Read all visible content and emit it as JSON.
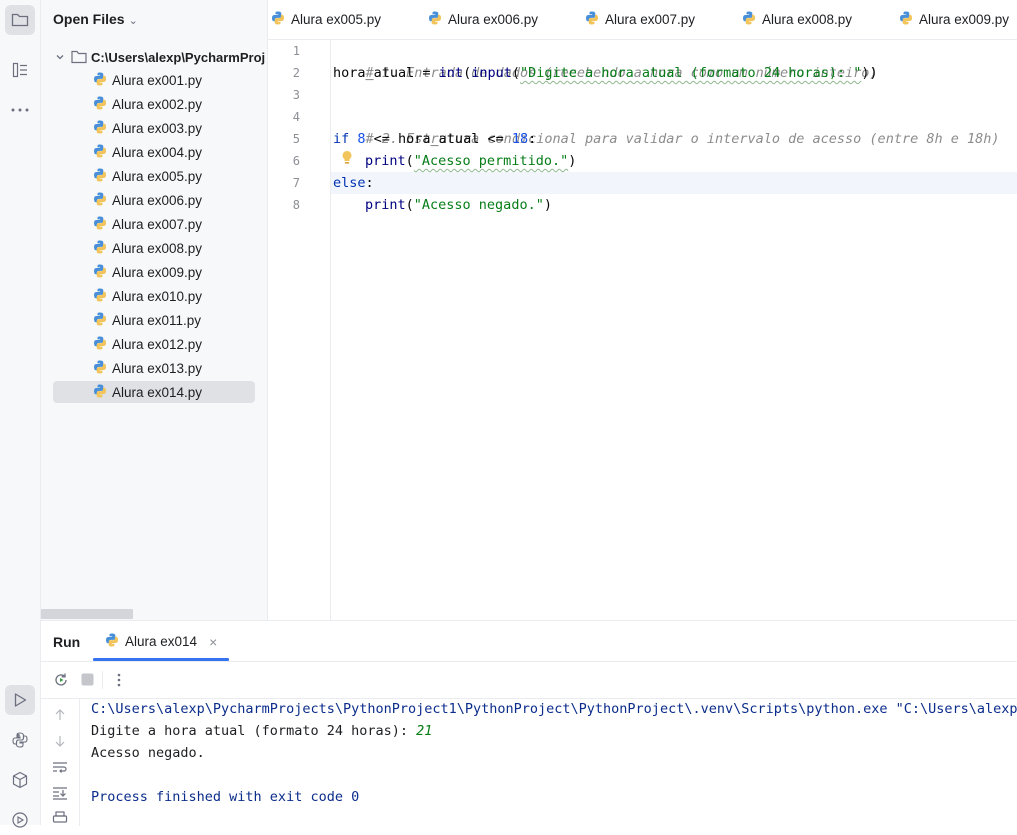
{
  "project_panel": {
    "title": "Open Files",
    "root_label": "C:\\Users\\alexp\\PycharmProj",
    "files": [
      "Alura ex001.py",
      "Alura ex002.py",
      "Alura ex003.py",
      "Alura ex004.py",
      "Alura ex005.py",
      "Alura ex006.py",
      "Alura ex007.py",
      "Alura ex008.py",
      "Alura ex009.py",
      "Alura ex010.py",
      "Alura ex011.py",
      "Alura ex012.py",
      "Alura ex013.py",
      "Alura ex014.py"
    ],
    "selected_file": "Alura ex014.py"
  },
  "tabs": [
    "Alura ex005.py",
    "Alura ex006.py",
    "Alura ex007.py",
    "Alura ex008.py",
    "Alura ex009.py"
  ],
  "editor": {
    "line_numbers": [
      "1",
      "2",
      "3",
      "4",
      "5",
      "6",
      "7",
      "8"
    ],
    "current_line": 7,
    "code": {
      "l1": "# 1. Entrada de dados (recebendo a hora como um número inteiro)",
      "l2_var": "hora_atual = ",
      "l2_int": "int",
      "l2_open": "(",
      "l2_input": "input",
      "l2_open2": "(",
      "l2_str": "\"Digite a hora atual (formato 24 horas): \"",
      "l2_close": "))",
      "l4": "# 2. Estrutura condicional para validar o intervalo de acesso (entre 8h e 18h)",
      "l5_if": "if ",
      "l5_8": "8",
      "l5_mid": " <= hora_atual <= ",
      "l5_18": "18",
      "l5_colon": ":",
      "l6_print": "print",
      "l6_str": "\"Acesso permitido.\"",
      "l7_else": "else",
      "l7_colon": ":",
      "l8_print": "print",
      "l8_str": "\"Acesso negado.\""
    }
  },
  "run_panel": {
    "title": "Run",
    "tab_label": "Alura ex014",
    "console": {
      "command": "C:\\Users\\alexp\\PycharmProjects\\PythonProject1\\PythonProject\\PythonProject\\.venv\\Scripts\\python.exe \"C:\\Users\\alexp\\P",
      "prompt": "Digite a hora atual (formato 24 horas): ",
      "user_input": "21",
      "output": "Acesso negado.",
      "exit_message": "Process finished with exit code 0"
    }
  },
  "colors": {
    "accent": "#3574f0",
    "keyword": "#0033b3",
    "string": "#067d17",
    "number": "#1750eb",
    "comment": "#8c8c8c"
  }
}
